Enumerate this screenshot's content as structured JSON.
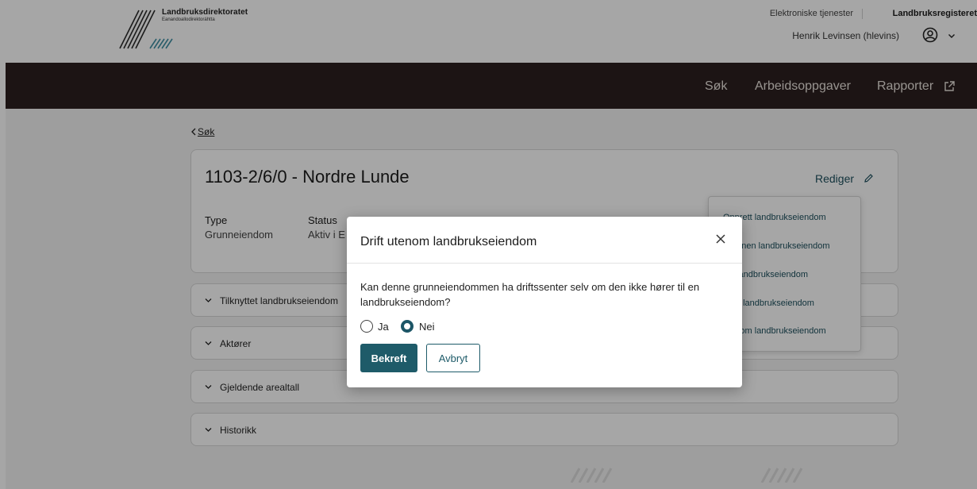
{
  "header": {
    "brand_name": "Landbruksdirektoratet",
    "brand_sub": "Eanandoallodirektoráhtta",
    "services_link": "Elektroniske tjenester",
    "register_link": "Landbruksregisteret",
    "user_name": "Henrik Levinsen (hlevins)"
  },
  "nav": {
    "search": "Søk",
    "tasks": "Arbeidsoppgaver",
    "reports": "Rapporter"
  },
  "breadcrumb": {
    "back": "Søk"
  },
  "property": {
    "title": "1103-2/6/0 - Nordre Lunde",
    "edit": "Rediger",
    "fields": [
      {
        "label": "Type",
        "value": "Grunneiendom"
      },
      {
        "label": "Status",
        "value": "Aktiv i E"
      }
    ]
  },
  "sections": [
    "Tilknyttet landbrukseiendom",
    "Aktører",
    "Gjeldende arealtall",
    "Historikk"
  ],
  "edit_menu": [
    "Opprett landbrukseiendom",
    "til annen landbrukseiendom",
    "t til landbrukseiendom",
    "n fra landbrukseiendom",
    "utenom landbrukseiendom"
  ],
  "modal": {
    "title": "Drift utenom landbrukseiendom",
    "question": "Kan denne grunneiendommen ha driftssenter selv om den ikke hører til en landbrukseiendom?",
    "option_yes": "Ja",
    "option_no": "Nei",
    "selected": "Nei",
    "confirm": "Bekreft",
    "cancel": "Avbryt"
  },
  "colors": {
    "navbar": "#2c2020",
    "primary": "#1e5b69",
    "link": "#1c4f5d"
  }
}
